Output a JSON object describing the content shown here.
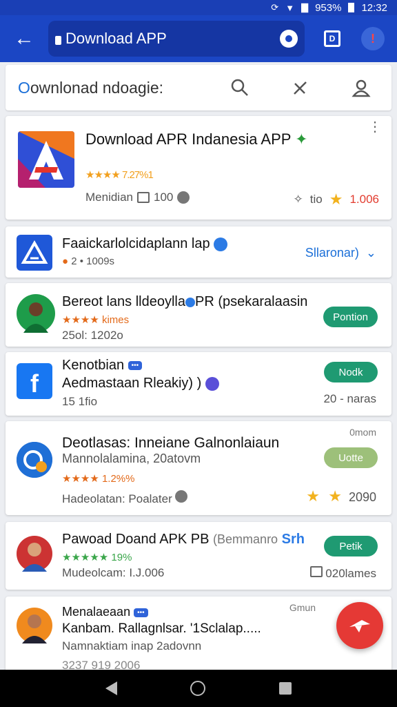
{
  "status": {
    "battery": "953%",
    "time": "12:32"
  },
  "appbar": {
    "query": "Download APP",
    "tabs_label": "D",
    "profile_label": "!"
  },
  "toolbar": {
    "title_prefix": "O",
    "title_rest": "ownlonad ndoagie:"
  },
  "hero": {
    "title": "Download APR Indanesia APP",
    "title_mark": "✦",
    "rating_text": "★★★★ 7.27%1",
    "meta_left": "Menidian",
    "meta_count": "100",
    "meta_tag": "tio",
    "meta_score": "1.006"
  },
  "rows": [
    {
      "title": "Faaickarlolcidaplann lap",
      "sub": "2  • 1009s",
      "right": "Sllaronar)"
    },
    {
      "title": "Bereot lans lldeoylla",
      "title2": "PR (psekaralaasin",
      "rating": "★★★★ kimes",
      "meta": "25ol:   1202o",
      "button": "Pontion"
    },
    {
      "title": "Kenotbian",
      "title2": "Aedmastaan Rleakiy) )",
      "meta": "15   1fio",
      "button": "Nodk",
      "right": "20 - naras"
    },
    {
      "title": "Deotlasas: Inneiane Galnonlaiaun",
      "sub": "Mannolalamina, 20atovm",
      "rating": "★★★★ 1.2%%",
      "meta": "Hadeolatan:   Poalater",
      "top_right": "0mom",
      "button": "Uotte",
      "right": "2090"
    },
    {
      "title": "Pawoad Doand APK PB",
      "title2": "(Bemmanro",
      "title3": "Srh",
      "rating": "★★★★★ 19%",
      "meta": "Mudeolcam:   I.J.006",
      "button": "Petik",
      "right": "020lames"
    },
    {
      "title": "Menalaeaan",
      "title2": "Kanbam. Rallagnlsar. '1Sclalap.....",
      "sub": "Namnaktiam inap 2adovnn",
      "top_right": "Gmun",
      "meta": "3237 919  2006"
    }
  ],
  "colors": {
    "primary": "#1b46c4",
    "fab": "#e53935",
    "install": "#1f9a72"
  }
}
